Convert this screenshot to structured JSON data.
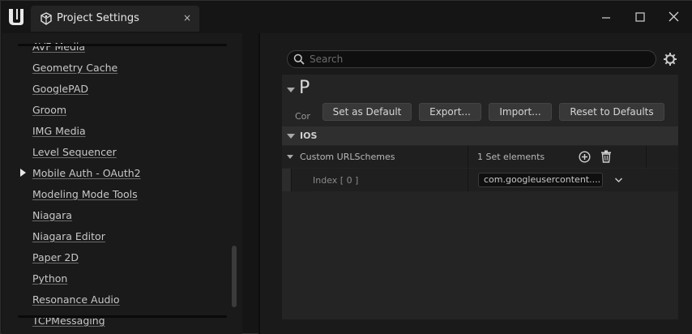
{
  "titlebar": {
    "tab_title": "Project Settings",
    "close_glyph": "×"
  },
  "sidebar": {
    "items": [
      {
        "label": "AVF Media"
      },
      {
        "label": "Geometry Cache"
      },
      {
        "label": "GooglePAD"
      },
      {
        "label": "Groom"
      },
      {
        "label": "IMG Media"
      },
      {
        "label": "Level Sequencer"
      },
      {
        "label": "Mobile Auth - OAuth2"
      },
      {
        "label": "Modeling Mode Tools"
      },
      {
        "label": "Niagara"
      },
      {
        "label": "Niagara Editor"
      },
      {
        "label": "Paper 2D"
      },
      {
        "label": "Python"
      },
      {
        "label": "Resonance Audio"
      },
      {
        "label": "TCPMessaging"
      }
    ]
  },
  "search": {
    "placeholder": "Search"
  },
  "panel": {
    "title": "P",
    "subtitle": "Cor",
    "buttons": {
      "set_default": "Set as Default",
      "export": "Export...",
      "import": "Import...",
      "reset": "Reset to Defaults"
    },
    "section": {
      "label": "IOS"
    },
    "property": {
      "label": "Custom URLSchemes",
      "summary": "1 Set elements"
    },
    "element": {
      "label": "Index [ 0 ]",
      "value": "com.googleusercontent...."
    }
  },
  "colors": {
    "background": "#151515",
    "pane": "#1a1a1a",
    "panel": "#242424",
    "button": "#383838",
    "text": "#c8c8c8"
  },
  "icons": [
    "unreal-logo-icon",
    "settings-cube-icon",
    "close-icon",
    "minimize-icon",
    "maximize-icon",
    "window-close-icon",
    "search-icon",
    "gear-icon",
    "add-circle-icon",
    "trash-icon",
    "chevron-down-icon",
    "expand-arrow-icon"
  ]
}
